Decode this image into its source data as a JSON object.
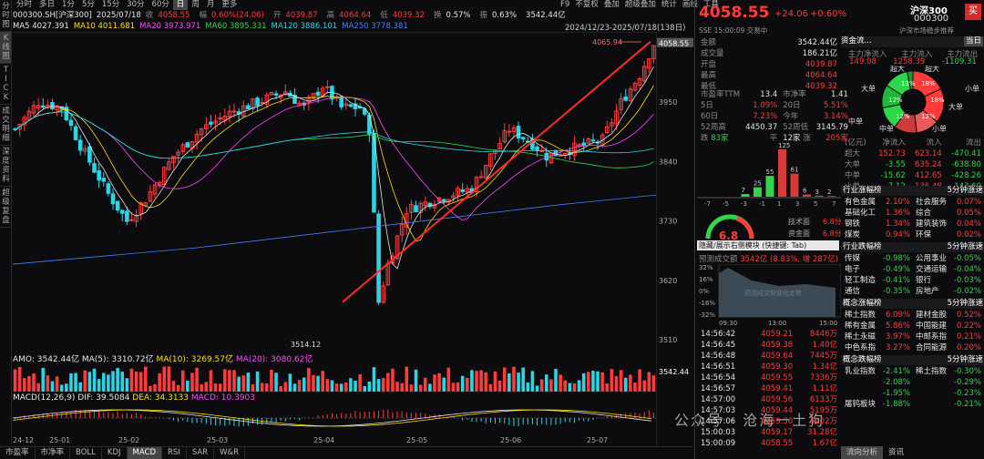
{
  "left_sidebar": [
    "分时图",
    "K线图",
    "TICK",
    "成交明细",
    "深度资料",
    "超级复盘"
  ],
  "top_tabs": [
    "分时",
    "多日",
    "1分",
    "5分",
    "15分",
    "30分",
    "60分",
    "日",
    "周",
    "月",
    "更多"
  ],
  "top_tools": [
    "F9",
    "不复权",
    "叠加",
    "超级叠加",
    "统计",
    "画线",
    "工具"
  ],
  "info": {
    "code": "000300.SH[沪深300]",
    "date": "2025/07/18",
    "close_label": "收",
    "close": "4058.55",
    "change_label": "幅",
    "change": "0.60%(24.06)",
    "open_label": "开",
    "open": "4039.87",
    "high_label": "高",
    "high": "4064.64",
    "low_label": "低",
    "low": "4039.32",
    "turnover_label": "换",
    "turnover": "0.57%",
    "amp_label": "振",
    "amp": "0.63%",
    "amount": "3542.44亿"
  },
  "ma_line": [
    {
      "label": "MA5 4027.391",
      "color": "#e6e6e6"
    },
    {
      "label": "MA10 4011.681",
      "color": "#ffe000"
    },
    {
      "label": "MA20 3973.971",
      "color": "#ff49ff"
    },
    {
      "label": "MA60 3895.331",
      "color": "#2fd54a"
    },
    {
      "label": "MA120 3886.101",
      "color": "#29d6e6"
    },
    {
      "label": "MA250 3778.381",
      "color": "#4a7dff"
    }
  ],
  "date_range": "2024/12/23-2025/07/18(138日)",
  "chart_data": {
    "type": "candlestick",
    "y_ticks": [
      "4058.55",
      "3950",
      "3840",
      "3730",
      "3620",
      "3510"
    ],
    "y_values": [
      4058.55,
      3950,
      3840,
      3730,
      3620,
      3510
    ],
    "x_ticks": [
      "24-12",
      "25-01",
      "25-02",
      "25-03",
      "25-04",
      "25-05",
      "25-06",
      "25-07"
    ],
    "annotations": {
      "high": "4065.94",
      "low": "3514.12"
    },
    "last_price_label": "4058.55"
  },
  "amo": {
    "title": "AMO: 3542.44亿",
    "ma5": "MA(5): 3310.72亿",
    "ma10": "MA(10): 3269.57亿",
    "ma20": "MA(20): 3080.62亿",
    "last": "3542.44"
  },
  "macd": {
    "title": "MACD(12,26,9)",
    "dif": "DIF: 39.5084",
    "dea": "DEA: 34.3133",
    "macd": "MACD: 10.3903"
  },
  "bottom_tabs": [
    "市盈率",
    "市净率",
    "BOLL",
    "KDJ",
    "MACD",
    "RSI",
    "SAR",
    "W&R"
  ],
  "watermark": "公众号 · 沧海一土狗",
  "rp": {
    "price": "4058.55",
    "chg": "+24.06",
    "pct": "+0.60%",
    "name": "沪深300",
    "code": "000300",
    "buy": "买",
    "sub": "SSE 15:00:09 交易中",
    "sub2": "沪深市场稳步推荐",
    "stats": [
      [
        "金额",
        "3542.44亿"
      ],
      [
        "成交量",
        "186.21亿"
      ],
      [
        "开盘",
        "4039.87"
      ],
      [
        "最高",
        "4064.64"
      ],
      [
        "最低",
        "4039.32"
      ]
    ],
    "pe": "13.4",
    "pb": "1.41",
    "d5": "1.09%",
    "d20": "5.51%",
    "d60": "7.23%",
    "ytd": "3.14%",
    "w52h": "4450.37",
    "w52l": "3145.79",
    "down": "83家",
    "flat": "平",
    "up12": "12家",
    "rise": "205家",
    "flow_title": "资金流...",
    "today_btn": "当日",
    "flow_head": [
      "主力净流入",
      "主力流入",
      "主力流出"
    ],
    "flow_vals": [
      "149.08",
      "1258.39",
      "-1109.31"
    ],
    "pie_labels": [
      "超大",
      "超大",
      "大单",
      "大单",
      "中单",
      "中单",
      "小单",
      "小单"
    ],
    "pie_pcts": [
      "13%",
      "18%",
      "18%",
      "12%",
      "12%",
      "12%"
    ],
    "flow_table": [
      [
        "(亿元)",
        "净流入",
        "流入",
        "流出"
      ],
      [
        "超大",
        "152.73",
        "623.14",
        "-470.41"
      ],
      [
        "大单",
        "-3.55",
        "635.24",
        "-638.80"
      ],
      [
        "中单",
        "-15.62",
        "412.65",
        "-428.26"
      ],
      [
        "小单",
        "-7.12",
        "136.48",
        "-143.60"
      ]
    ],
    "dist_vals": [
      "125",
      "61",
      "55",
      "25",
      "7",
      "6",
      "3",
      "2"
    ],
    "dist_x": [
      "-7",
      "-5",
      "-3",
      "-1",
      "1",
      "3",
      "5",
      "7"
    ],
    "gauge": "6.8",
    "tech": "技术面",
    "tech_v": "6.8分",
    "base": "资金面",
    "base_v": "6.8分",
    "hide_tip": "隐藏/展示右侧模块 (快捷键: Tab)",
    "forecast": "预测成交额",
    "forecast_v": "3542亿 (8.83%, 增 287亿)",
    "forecast_ph": "预测成交额变化走势",
    "fy": [
      "32%",
      "16%",
      "0%",
      "-16%",
      "-32%"
    ],
    "fx": [
      "09:30",
      "13:00",
      "15:00"
    ],
    "ind_up_title": "行业涨幅榜",
    "ind_5m": "5分钟涨速",
    "ind_up": [
      [
        "有色金属",
        "2.10%",
        "社会服务",
        "0.07%"
      ],
      [
        "基础化工",
        "1.36%",
        "综合",
        "0.05%"
      ],
      [
        "钢铁",
        "1.34%",
        "建筑装饰",
        "0.04%"
      ],
      [
        "煤炭",
        "0.94%",
        "环保",
        "0.02%"
      ]
    ],
    "ind_dn_title": "行业跌幅榜",
    "ind_dn": [
      [
        "传媒",
        "-0.98%",
        "公用事业",
        "-0.05%"
      ],
      [
        "电子",
        "-0.49%",
        "交通运输",
        "-0.04%"
      ],
      [
        "轻工制造",
        "-0.41%",
        "银行",
        "-0.03%"
      ],
      [
        "通信",
        "-0.35%",
        "房地产",
        "-0.02%"
      ]
    ],
    "con_up_title": "概念涨幅榜",
    "con_up": [
      [
        "稀土指数",
        "6.09%",
        "建材金股",
        "0.52%"
      ],
      [
        "稀有金属",
        "5.86%",
        "中国能建",
        "0.22%"
      ],
      [
        "稀土永磁",
        "3.97%",
        "中邮系指",
        "0.21%"
      ],
      [
        "中色系指",
        "3.27%",
        "合同能源",
        "0.20%"
      ]
    ],
    "con_dn_title": "概念跌幅榜",
    "con_dn": [
      [
        "乳业指数",
        "-2.41%",
        "稀土指数",
        "-0.30%"
      ],
      [
        "",
        "-2.08%",
        "",
        "-0.29%"
      ],
      [
        "",
        "-1.95%",
        "",
        "-0.23%"
      ],
      [
        "屠钨板块",
        "-1.88%",
        "",
        "-0.21%"
      ]
    ],
    "ticks": [
      [
        "14:56:42",
        "4059.21",
        "8446万"
      ],
      [
        "14:56:45",
        "4059.38",
        "1.40亿"
      ],
      [
        "14:56:48",
        "4059.64",
        "7445万"
      ],
      [
        "14:56:51",
        "4059.30",
        "1.34亿"
      ],
      [
        "14:56:54",
        "4059.55",
        "7336万"
      ],
      [
        "14:56:57",
        "4059.41",
        "1.11亿"
      ],
      [
        "14:57:00",
        "4059.56",
        "6133万"
      ],
      [
        "14:57:03",
        "4059.44",
        "5195万"
      ],
      [
        "14:57:06",
        "4059.30",
        "5102万"
      ],
      [
        "15:00:03",
        "4059.17",
        "31.28亿"
      ],
      [
        "15:00:09",
        "4058.55",
        "1.67亿"
      ]
    ],
    "bottom_tabs": [
      "流向分析",
      "资讯"
    ]
  }
}
